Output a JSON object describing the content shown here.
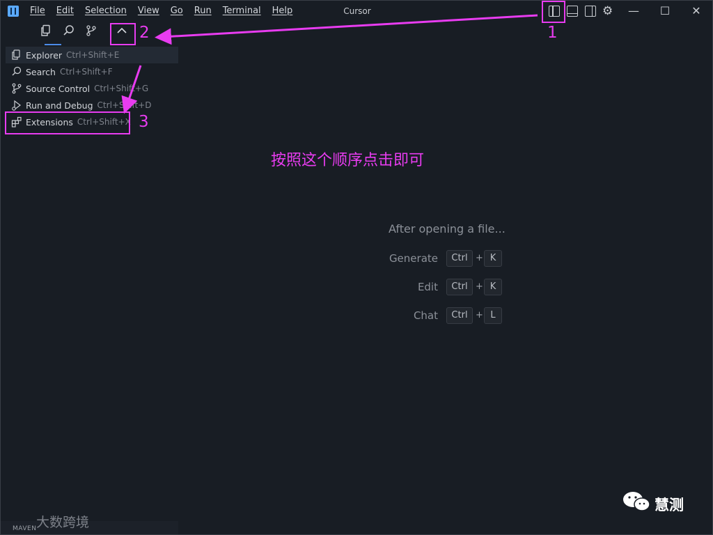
{
  "window": {
    "title": "Cursor"
  },
  "menubar": {
    "items": [
      "File",
      "Edit",
      "Selection",
      "View",
      "Go",
      "Run",
      "Terminal",
      "Help"
    ]
  },
  "title_icons": [
    "toggle-primary-sidebar-icon",
    "toggle-panel-icon",
    "toggle-secondary-sidebar-icon",
    "gear-icon"
  ],
  "window_controls": {
    "minimize": "—",
    "maximize": "☐",
    "close": "✕"
  },
  "activity_bar": {
    "icons": [
      "explorer-icon",
      "search-icon",
      "source-control-icon",
      "chevron-up-icon"
    ]
  },
  "sidebar_menu": {
    "items": [
      {
        "label": "Explorer",
        "shortcut": "Ctrl+Shift+E"
      },
      {
        "label": "Search",
        "shortcut": "Ctrl+Shift+F"
      },
      {
        "label": "Source Control",
        "shortcut": "Ctrl+Shift+G"
      },
      {
        "label": "Run and Debug",
        "shortcut": "Ctrl+Shift+D"
      },
      {
        "label": "Extensions",
        "shortcut": "Ctrl+Shift+X"
      }
    ]
  },
  "welcome": {
    "title": "After opening a file...",
    "rows": [
      {
        "label": "Generate",
        "key1": "Ctrl",
        "plus": "+",
        "key2": "K"
      },
      {
        "label": "Edit",
        "key1": "Ctrl",
        "plus": "+",
        "key2": "K"
      },
      {
        "label": "Chat",
        "key1": "Ctrl",
        "plus": "+",
        "key2": "L"
      }
    ]
  },
  "annotations": {
    "numbers": [
      "1",
      "2",
      "3"
    ],
    "instruction": "按照这个顺序点击即可",
    "color": "#e83cf0"
  },
  "watermarks": {
    "left_text": "大数跨境",
    "left_small": "MAVEN",
    "right_text": "慧测"
  },
  "colors": {
    "background": "#181d24",
    "accent": "#4b8be8"
  }
}
